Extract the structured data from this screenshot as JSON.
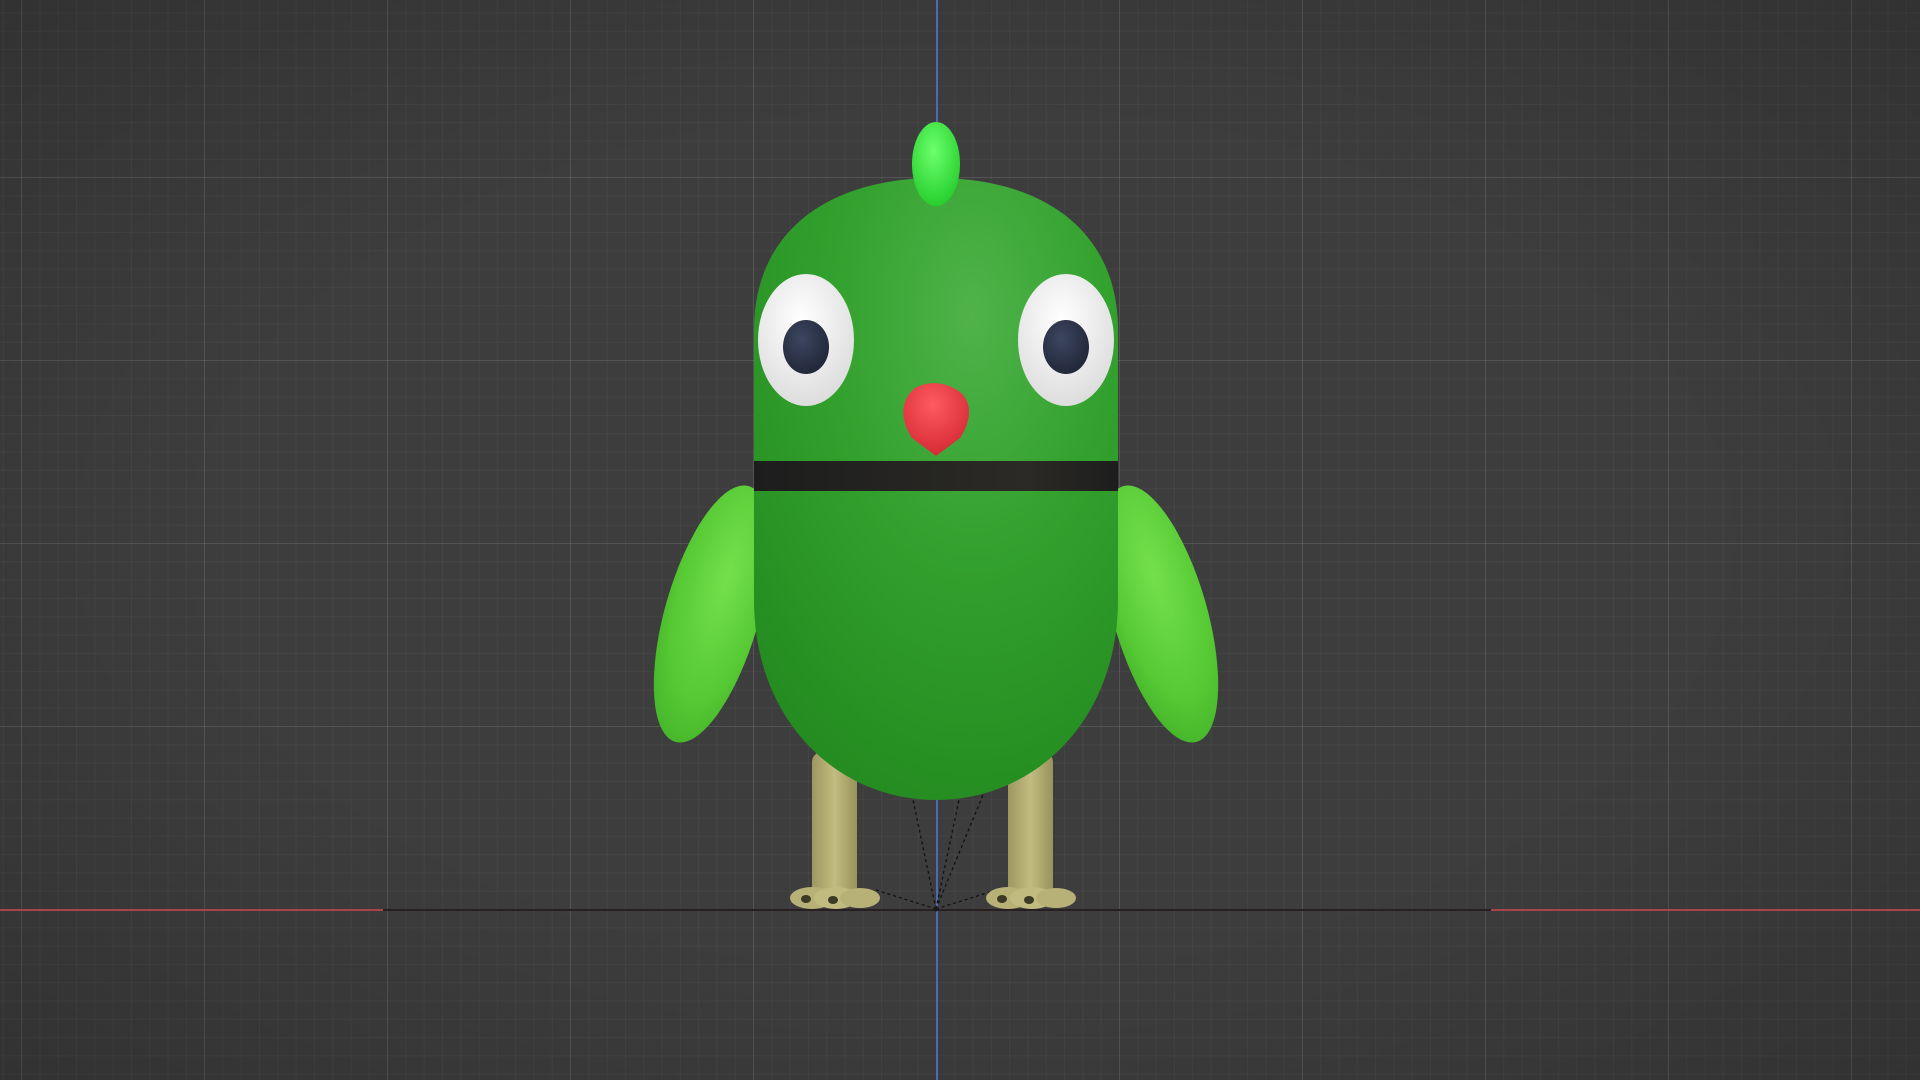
{
  "viewport": {
    "background_color": "#3d3d3d",
    "axis_colors": {
      "z": "#4a6db0",
      "x": "#a9444a",
      "x_center": "#2a1f20"
    }
  },
  "character": {
    "body_color": "#2f9a2a",
    "wing_color": "#55c832",
    "crest_color": "#33dd33",
    "beak_color": "#e2333a",
    "band_color": "#232323",
    "eye_white": "#f0f0f0",
    "pupil_color": "#283044",
    "leg_color": "#b3ad72"
  }
}
